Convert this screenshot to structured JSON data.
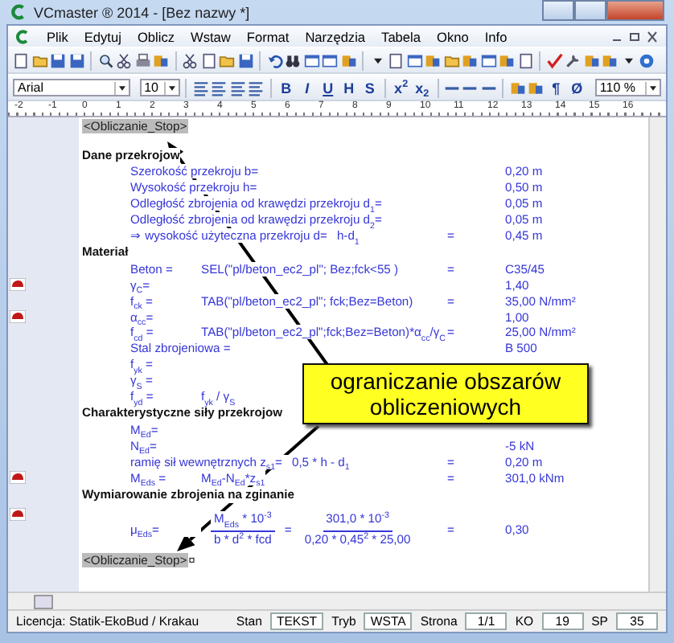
{
  "window": {
    "title": "VCmaster ® 2014 - [Bez nazwy *]"
  },
  "menu": [
    "Plik",
    "Edytuj",
    "Oblicz",
    "Wstaw",
    "Format",
    "Narzędzia",
    "Tabela",
    "Okno",
    "Info"
  ],
  "format_bar": {
    "font": "Arial",
    "size": "10",
    "styles": [
      "B",
      "I",
      "U",
      "H",
      "S"
    ],
    "scripts": [
      "x$^{2}$",
      "x$_{2}$"
    ],
    "paragraph": "¶",
    "empty_set": "Ø",
    "zoom": "110 %"
  },
  "ruler": [
    "-2",
    "-1",
    "0",
    "1",
    "2",
    "3",
    "4",
    "5",
    "6",
    "7",
    "8",
    "9",
    "10",
    "11",
    "12",
    "13",
    "14",
    "15",
    "16"
  ],
  "document": [
    {
      "kind": "tag",
      "text": "<Obliczanie_Stop>"
    },
    {
      "kind": "heading",
      "text": "Dane przekrojow"
    },
    {
      "kind": "line",
      "label": "Szerokość przekroju b=",
      "value": "0,20 m",
      "marker": false
    },
    {
      "kind": "line",
      "label": "Wysokość przekroju h=",
      "value": "0,50 m",
      "marker": false
    },
    {
      "kind": "line",
      "label": "Odległość zbrojenia od krawędzi przekroju d$_{1}$=",
      "value": "0,05 m",
      "marker": false
    },
    {
      "kind": "line",
      "label": "Odległość zbrojenia od krawędzi przekroju d$_{2}$=",
      "value": "0,05 m",
      "marker": false
    },
    {
      "kind": "line",
      "label": "⇒ wysokość użyteczna przekroju d=",
      "formula": "h-d$_{1}$",
      "eq": "=",
      "value": "0,45 m",
      "marker": false
    },
    {
      "kind": "heading",
      "text": "Materiał"
    },
    {
      "kind": "line",
      "label": "Beton =",
      "formula": "SEL(\"pl/beton_ec2_pl\"; Bez;fck<55 )",
      "eq": "=",
      "value": "C35/45",
      "marker": false
    },
    {
      "kind": "line",
      "label": "γ$_{C}$=",
      "value": "1,40",
      "marker": true
    },
    {
      "kind": "line",
      "label": "f$_{ck}$ =",
      "formula": "TAB(\"pl/beton_ec2_pl\"; fck;Bez=Beton)",
      "eq": "=",
      "value": "35,00 N/mm²",
      "marker": false
    },
    {
      "kind": "line",
      "label": "α$_{cc}$=",
      "value": "1,00",
      "marker": true
    },
    {
      "kind": "line",
      "label": "f$_{cd}$ =",
      "formula": "TAB(\"pl/beton_ec2_pl\";fck;Bez=Beton)*α$_{cc}$/γ$_{C}$",
      "eq": "=",
      "value": "25,00 N/mm²",
      "marker": false
    },
    {
      "kind": "line",
      "label": "Stal zbrojeniowa =",
      "value": "B 500",
      "marker": false
    },
    {
      "kind": "line",
      "label": "f$_{yk}$ =",
      "marker": false
    },
    {
      "kind": "line",
      "label": "γ$_{S}$ =",
      "marker": false
    },
    {
      "kind": "line",
      "label": "f$_{yd}$ =",
      "formula": "f$_{yk}$ / γ$_{S}$",
      "marker": false
    },
    {
      "kind": "heading",
      "text": "Charakterystyczne siły przekrojow"
    },
    {
      "kind": "line",
      "label": "M$_{Ed}$=",
      "marker": false
    },
    {
      "kind": "line",
      "label": "N$_{Ed}$=",
      "value": "-5 kN",
      "marker": false
    },
    {
      "kind": "line",
      "label": "ramię sił wewnętrznych z$_{s1}$=",
      "formula": "0,5 * h - d$_{1}$",
      "eq": "=",
      "value": "0,20 m",
      "marker": false
    },
    {
      "kind": "line",
      "label": "M$_{Eds}$ =",
      "formula": "M$_{Ed}$-N$_{Ed}$*z$_{s1}$",
      "eq": "=",
      "value": "301,0 kNm",
      "marker": true
    },
    {
      "kind": "heading",
      "text": "Wymiarowanie zbrojenia na zginanie"
    },
    {
      "kind": "fraction",
      "label": "μ$_{Eds}$=",
      "num": "M$_{Eds}$ * 10$^{-3}$",
      "den": "b * d$^{2}$ * fcd",
      "mid": "=",
      "num2": "301,0 * 10$^{-3}$",
      "den2": "0,20 * 0,45$^{2}$ * 25,00",
      "eq": "=",
      "value": "0,30",
      "marker": true
    },
    {
      "kind": "tag",
      "text": "<Obliczanie_Stop>",
      "end_mark": "¤"
    }
  ],
  "callout": [
    "ograniczanie obszarów",
    "obliczeniowych"
  ],
  "status_bar": {
    "license": "Licencja: Statik-EkoBud / Krakau",
    "fields": [
      {
        "label": "Stan",
        "value": "TEKST"
      },
      {
        "label": "Tryb",
        "value": "WSTA"
      },
      {
        "label": "Strona",
        "value": "1/1"
      },
      {
        "label": "KO",
        "value": "19"
      },
      {
        "label": "SP",
        "value": "35"
      }
    ]
  }
}
